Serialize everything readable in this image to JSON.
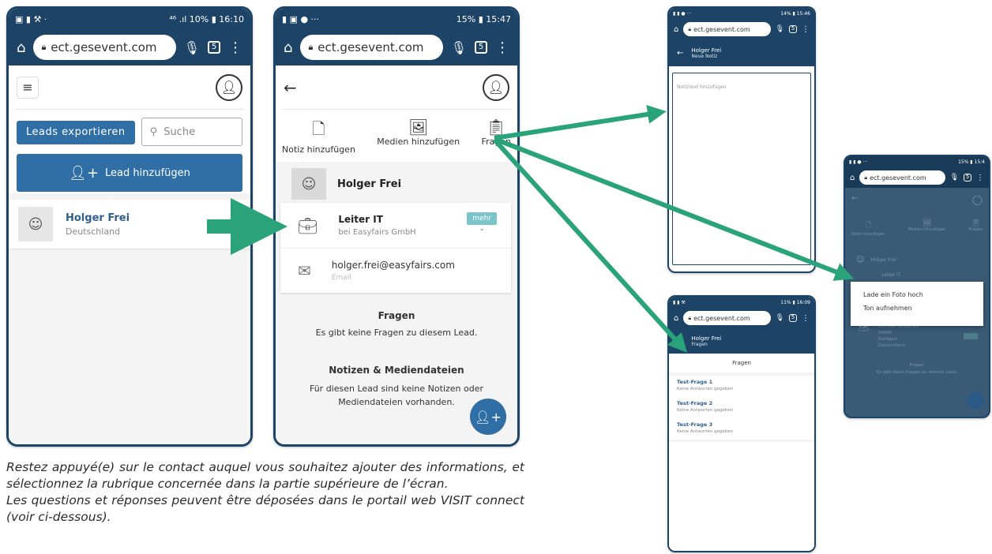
{
  "url": "ect.gesevent.com",
  "tabs_count": "5",
  "colors": {
    "navy": "#1d4466",
    "accent": "#2f6fa6",
    "arrow": "#2aa37a",
    "teal_badge": "#7cc4cc"
  },
  "phone1": {
    "status_right": "⁴⁶ .ıl 10% ▮ 16:10",
    "export_button": "Leads exportieren",
    "search_placeholder": "Suche",
    "add_lead_button": "Lead hinzufügen",
    "lead": {
      "name": "Holger Frei",
      "country": "Deutschland"
    }
  },
  "phone2": {
    "status_right": "15% ▮ 15:47",
    "actions": {
      "note": "Notiz hinzufügen",
      "media": "Medien hinzufügen",
      "questions": "Fragen"
    },
    "contact_name": "Holger Frei",
    "job_title": "Leiter IT",
    "company": "bei Easyfairs GmbH",
    "more_badge": "mehr",
    "email": "holger.frei@easyfairs.com",
    "email_label": "Email",
    "questions_title": "Fragen",
    "questions_empty": "Es gibt keine Fragen zu diesem Lead.",
    "notes_title": "Notizen & Mediendateien",
    "notes_empty": "Für diesen Lead sind keine Notizen oder Mediendateien vorhanden."
  },
  "phone3": {
    "status_right": "14% ▮ 15:46",
    "header_name": "Holger Frei",
    "header_sub": "Neue Notiz",
    "note_placeholder": "Notiztext hinzufügen"
  },
  "phone4": {
    "status_right": "11% ▮ 16:09",
    "header_name": "Holger Frei",
    "header_sub": "Fragen",
    "section_title": "Fragen",
    "questions": [
      {
        "title": "Test-Frage 1",
        "sub": "Keine Antworten gegeben"
      },
      {
        "title": "Test-Frage 2",
        "sub": "Keine Antworten gegeben"
      },
      {
        "title": "Test-Frage 3",
        "sub": "Keine Antworten gegeben"
      }
    ]
  },
  "phone5": {
    "status_right": "15% ▮ 15:4",
    "actions": {
      "note": "Notiz hinzufügen",
      "media": "Medien hinzufügen",
      "questions": "Fragen"
    },
    "contact_name": "Holger Frei",
    "job_title": "Leiter IT",
    "popup_items": [
      "Lade ein Foto hoch",
      "Ton aufnehmen"
    ],
    "address_street": "Kremser Straße 16",
    "address_zip": "70469",
    "address_city": "Stuttgart",
    "address_country": "Deutschland",
    "questions_title": "Fragen",
    "questions_empty": "Es gibt keine Fragen zu diesem Lead."
  },
  "caption": {
    "line1": "Restez appuyé(e) sur le contact auquel vous souhaitez ajouter des informations, et sélectionnez la rubrique concernée dans la partie supérieure de l’écran.",
    "line2": "Les questions et réponses peuvent être déposées dans le portail web VISIT connect (voir ci-dessous)."
  }
}
